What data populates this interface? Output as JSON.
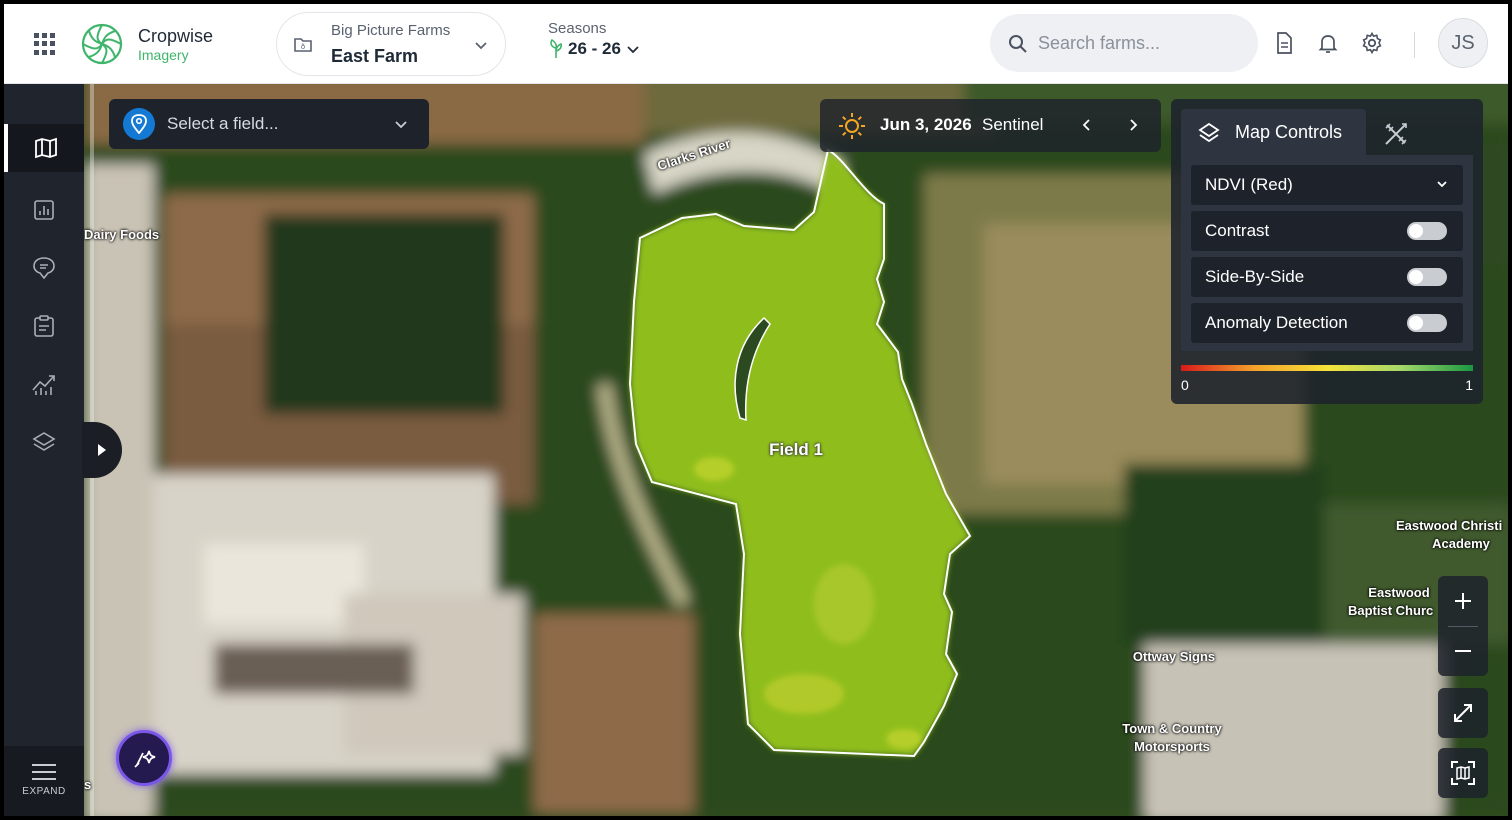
{
  "header": {
    "brand_name": "Cropwise",
    "brand_sub": "Imagery",
    "organization": "Big Picture Farms",
    "farm": "East Farm",
    "seasons_label": "Seasons",
    "season_value": "26 - 26",
    "search_placeholder": "Search farms...",
    "user_initials": "JS"
  },
  "sidebar": {
    "items": [
      {
        "name": "map",
        "icon": "map-icon",
        "active": true
      },
      {
        "name": "reports",
        "icon": "bar-chart-icon",
        "active": false
      },
      {
        "name": "scouting",
        "icon": "chat-pin-icon",
        "active": false
      },
      {
        "name": "tasks",
        "icon": "clipboard-icon",
        "active": false
      },
      {
        "name": "analytics",
        "icon": "trend-chart-icon",
        "active": false
      },
      {
        "name": "layers",
        "icon": "layers-icon",
        "active": false
      }
    ],
    "expand_label": "EXPAND"
  },
  "map": {
    "field_select_placeholder": "Select a field...",
    "date": "Jun 3, 2026",
    "source": "Sentinel",
    "field_label": "Field 1",
    "place_labels": {
      "river": "Clarks River",
      "dairy": "Dairy Foods",
      "academy_1": "Eastwood Christi",
      "academy_2": "Academy",
      "church_1": "Eastwood",
      "church_2": "Baptist Churc",
      "ottway": "Ottway Signs",
      "motors_1": "Town & Country",
      "motors_2": "Motorsports",
      "edge_s": "s"
    }
  },
  "map_controls": {
    "tab_label": "Map Controls",
    "layer_selected": "NDVI (Red)",
    "contrast_label": "Contrast",
    "contrast_on": false,
    "side_by_side_label": "Side-By-Side",
    "side_by_side_on": false,
    "anomaly_label": "Anomaly Detection",
    "anomaly_on": false,
    "legend_min": "0",
    "legend_max": "1",
    "legend_colors": [
      "#d7191c",
      "#f4a12a",
      "#f5e23a",
      "#a6d96a",
      "#1a9641"
    ]
  },
  "colors": {
    "accent_green": "#3fb56b",
    "sidebar_bg": "#20242d",
    "pin_blue": "#1479d3",
    "assistant_purple": "#7a57e8"
  }
}
